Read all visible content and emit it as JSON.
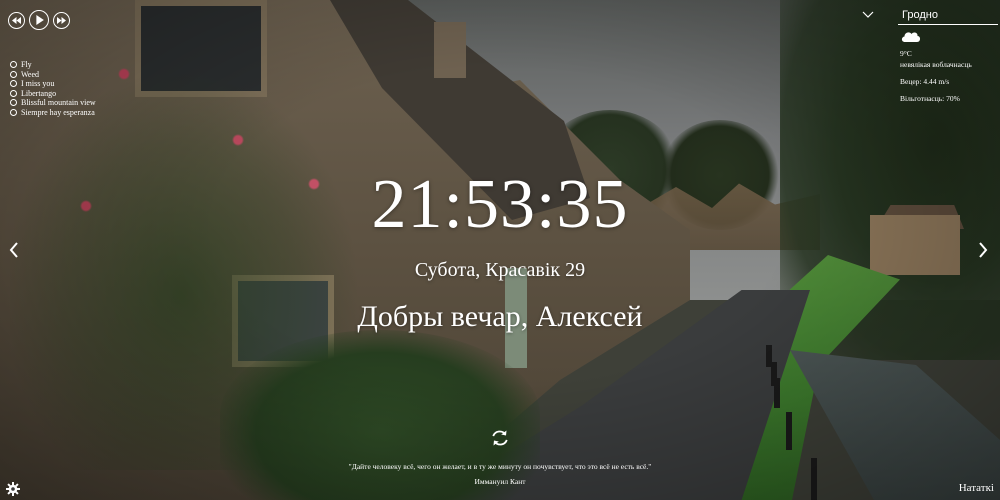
{
  "player": {
    "prev_icon": "skip-back-icon",
    "play_icon": "play-icon",
    "next_icon": "skip-forward-icon",
    "playlist": [
      "Fly",
      "Weed",
      "I miss you",
      "Libertango",
      "Blissful mountain view",
      "Siempre hay esperanza"
    ]
  },
  "clock": {
    "time": "21:53:35"
  },
  "date": {
    "text": "Субота, Красавік 29"
  },
  "greeting": {
    "text": "Добры вечар, Алексей"
  },
  "weather": {
    "city": "Гродно",
    "icon": "cloud-icon",
    "temperature": "9°C",
    "description": "невялікая воблачнасць",
    "wind": "Вецер: 4.44 m/s",
    "humidity": "Вільготнасць: 70%"
  },
  "quote": {
    "text": "\"Дайте человеку всё, чего он желает, и в ту же минуту он почувствует, что это всё не есть всё.\"",
    "author": "Иммануил Кант"
  },
  "footer": {
    "notes_label": "Нататкі"
  },
  "colors": {
    "text": "#ffffff"
  }
}
